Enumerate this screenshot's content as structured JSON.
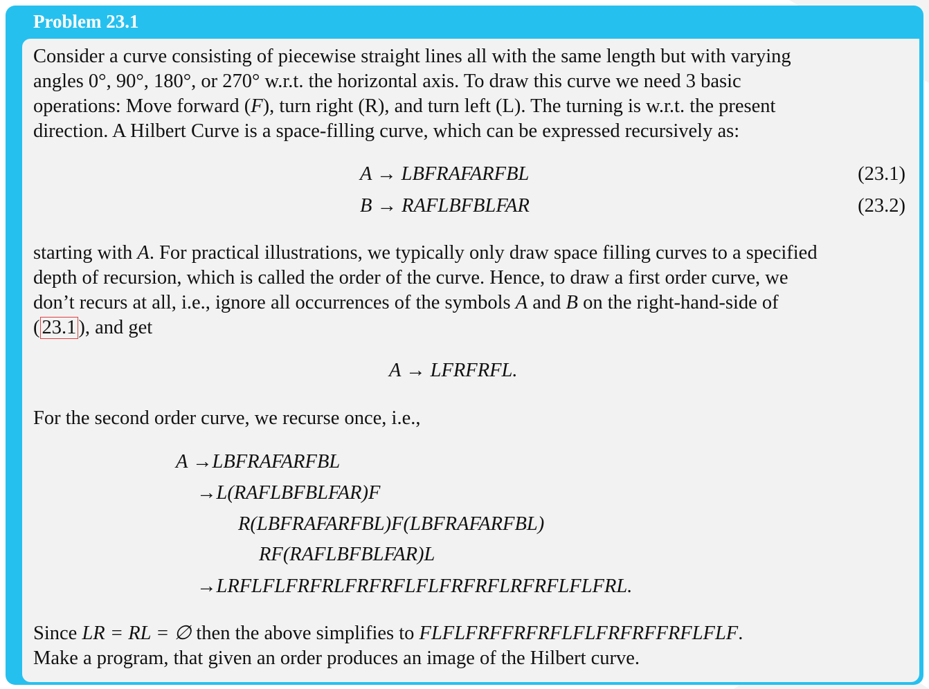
{
  "title": "Problem 23.1",
  "p1": {
    "l1": "Consider a curve consisting of piecewise straight lines all with the same length but with varying",
    "l2": "angles 0°, 90°, 180°, or 270° w.r.t. the horizontal axis. To draw this curve we need 3 basic",
    "l3a": "operations: Move forward (",
    "l3F": "F",
    "l3b": "), turn right (R), and turn left (L). The turning is w.r.t. the present",
    "l4": "direction. A Hilbert Curve is a space-filling curve, which can be expressed recursively as:"
  },
  "eq1": {
    "text": "A → LBFRAFARFBL",
    "num": "(23.1)"
  },
  "eq2": {
    "text": "B → RAFLBFBLFAR",
    "num": "(23.2)"
  },
  "p2": {
    "l1a": "starting with ",
    "l1A": "A",
    "l1b": ". For practical illustrations, we typically only draw space filling curves to a specified",
    "l2": "depth of recursion, which is called the order of the curve. Hence, to draw a first order curve, we",
    "l3a": "don’t recurs at all, i.e., ignore all occurrences of the symbols ",
    "l3A": "A",
    "l3and": " and ",
    "l3B": "B",
    "l3b": " on the right-hand-side of",
    "l4open": "(",
    "l4ref": "23.1",
    "l4b": "), and get"
  },
  "eq3": "A → LFRFRFL.",
  "p3": "For the second order curve, we recurse once, i.e.,",
  "deriv": [
    "A →LBFRAFARFBL",
    "→L(RAFLBFBLFAR)F",
    "R(LBFRAFARFBL)F(LBFRAFARFBL)",
    "RF(RAFLBFBLFAR)L",
    "→LRFLFLFRFRLFRFRFLFLFRFRFLRFRFLFLFRL."
  ],
  "p4": {
    "l1a": "Since ",
    "l1m": "LR = RL = ∅",
    "l1b": " then the above simplifies to ",
    "l1m2": "FLFLFRFFRFRFLFLFRFRFFRFLFLF",
    "l1c": ".",
    "l2": "Make a program, that given an order produces an image of the Hilbert curve."
  }
}
